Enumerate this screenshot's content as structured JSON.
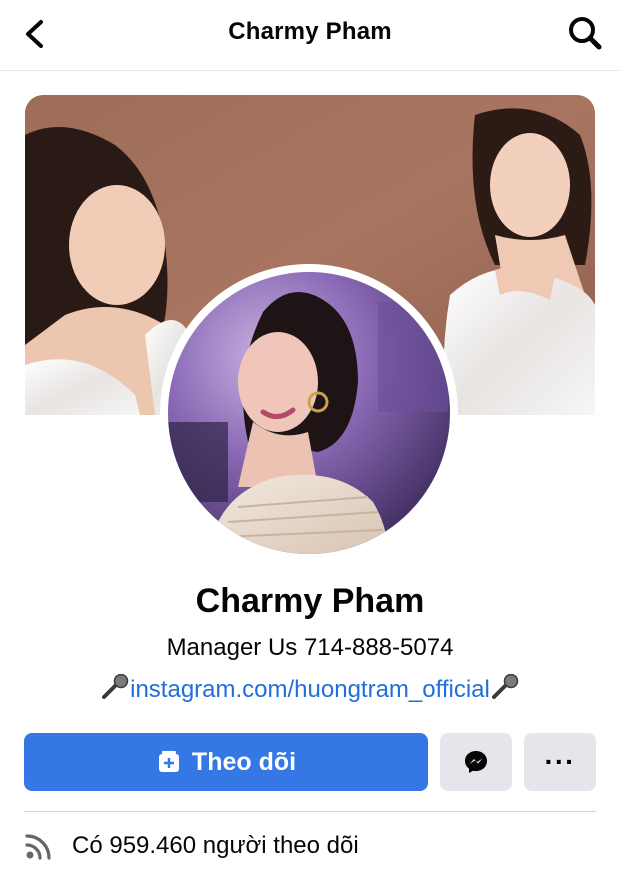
{
  "header": {
    "title": "Charmy Pham",
    "back_icon": "chevron-left-icon",
    "search_icon": "search-icon"
  },
  "profile": {
    "name": "Charmy Pham",
    "bio_line1": "Manager Us 714-888-5074",
    "bio_link": "instagram.com/huongtram_official",
    "bio_emoji": "microphone-icon"
  },
  "actions": {
    "follow_label": "Theo dõi",
    "follow_icon": "add-page-icon",
    "messenger_icon": "messenger-icon",
    "more_label": "···"
  },
  "stats": {
    "followers_text": "Có 959.460 người theo dõi",
    "followers_icon": "rss-feed-icon"
  },
  "colors": {
    "primary": "#3578e5",
    "link": "#216fdb",
    "button_gray": "#e4e6eb",
    "divider": "#ced0d4"
  }
}
